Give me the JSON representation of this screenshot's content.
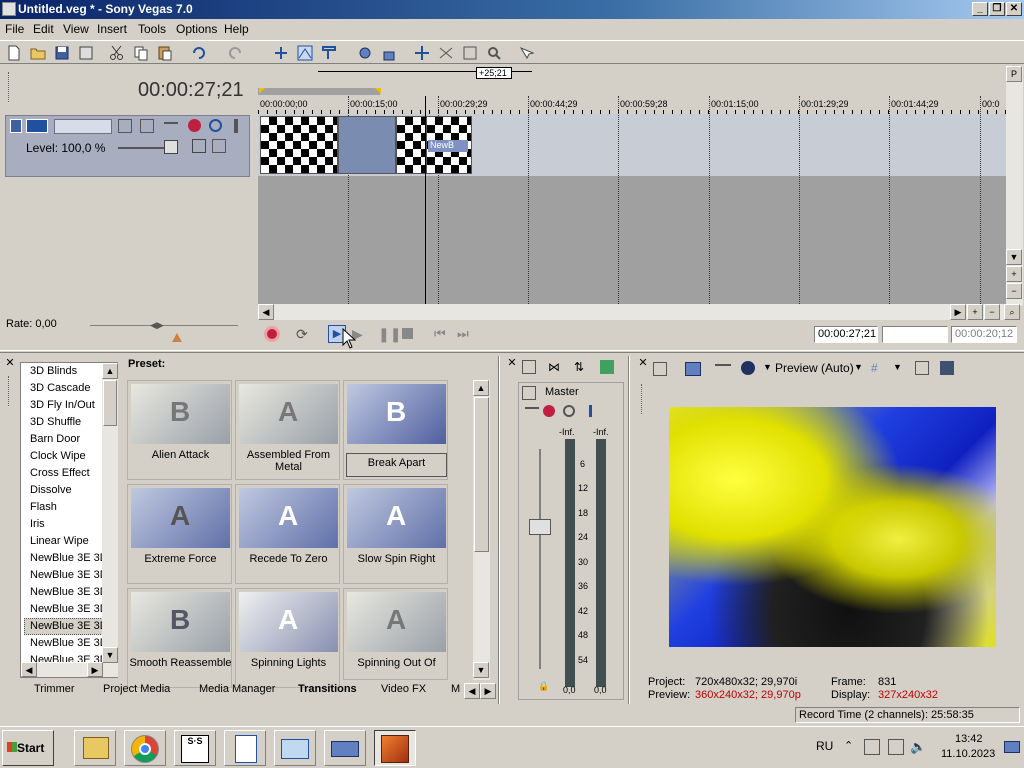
{
  "window": {
    "title": "Untitled.veg * - Sony Vegas 7.0",
    "btn_min": "_",
    "btn_max": "❐",
    "btn_close": "✕"
  },
  "menu": [
    "File",
    "Edit",
    "View",
    "Insert",
    "Tools",
    "Options",
    "Help"
  ],
  "timeline": {
    "cursor_time": "00:00:27;21",
    "selection_length": "+25;21",
    "ruler_labels": [
      "00:00:00;00",
      "00:00:15;00",
      "00:00:29;29",
      "00:00:44;29",
      "00:00:59;28",
      "00:01:15;00",
      "00:01:29;29",
      "00:01:44;29",
      "00:0"
    ],
    "track_level": "Level: 100,0 %",
    "transition_label": "NewB",
    "rate": "Rate: 0,00",
    "time_in": "00:00:27;21",
    "time_out": "",
    "time_len": "00:00:20;12"
  },
  "transitions_list": [
    "3D Blinds",
    "3D Cascade",
    "3D Fly In/Out",
    "3D Shuffle",
    "Barn Door",
    "Clock Wipe",
    "Cross Effect",
    "Dissolve",
    "Flash",
    "Iris",
    "Linear Wipe",
    "NewBlue 3E 3D",
    "NewBlue 3E 3D",
    "NewBlue 3E 3D",
    "NewBlue 3E 3D",
    "NewBlue 3E 3D",
    "NewBlue 3E 3D",
    "NewBlue 3E 3D"
  ],
  "selected_list_index": 15,
  "preset_label": "Preset:",
  "presets": [
    {
      "name": "Alien Attack",
      "letter": "B"
    },
    {
      "name": "Assembled From Metal",
      "letter": "A"
    },
    {
      "name": "Break Apart",
      "letter": "B"
    },
    {
      "name": "Extreme Force",
      "letter": "A"
    },
    {
      "name": "Recede To Zero",
      "letter": "A"
    },
    {
      "name": "Slow Spin Right",
      "letter": "A"
    },
    {
      "name": "Smooth Reassemble",
      "letter": "B"
    },
    {
      "name": "Spinning Lights",
      "letter": "A"
    },
    {
      "name": "Spinning Out Of",
      "letter": "A"
    }
  ],
  "tabs": [
    "Trimmer",
    "Project Media",
    "Media Manager",
    "Transitions",
    "Video FX",
    "M"
  ],
  "active_tab": "Transitions",
  "mixer": {
    "master_label": "Master",
    "peak_left": "-Inf.",
    "peak_right": "-Inf.",
    "scale": [
      "6",
      "12",
      "18",
      "24",
      "30",
      "36",
      "42",
      "48",
      "54"
    ],
    "bottom_left": "0,0",
    "bottom_right": "0,0"
  },
  "preview": {
    "mode": "Preview (Auto)",
    "project_label": "Project:",
    "project_value": "720x480x32; 29,970i",
    "preview_label": "Preview:",
    "preview_value": "360x240x32; 29,970p",
    "frame_label": "Frame:",
    "frame_value": "831",
    "display_label": "Display:",
    "display_value": "327x240x32"
  },
  "status": {
    "record_time": "Record Time (2 channels): 25:58:35"
  },
  "taskbar": {
    "start": "Start",
    "lang": "RU",
    "time": "13:42",
    "date": "11.10.2023"
  },
  "colors": {
    "title_bg": "#0a246a",
    "red_text": "#c00000",
    "track_header": "#a8aec0"
  }
}
